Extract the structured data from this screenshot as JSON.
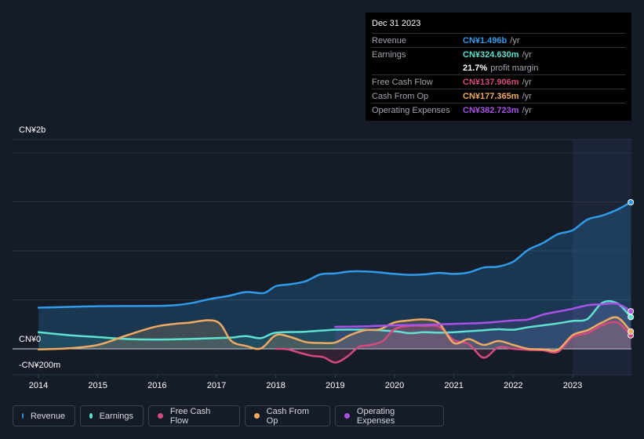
{
  "tooltip": {
    "date": "Dec 31 2023",
    "rows": [
      {
        "label": "Revenue",
        "value": "CN¥1.496b",
        "unit": "/yr",
        "color": "#2f9be9"
      },
      {
        "label": "Earnings",
        "value": "CN¥324.630m",
        "unit": "/yr",
        "color": "#5ee1d0"
      },
      {
        "label": "",
        "value": "21.7%",
        "unit": "profit margin",
        "color": "#ffffff"
      },
      {
        "label": "Free Cash Flow",
        "value": "CN¥137.906m",
        "unit": "/yr",
        "color": "#d6497e"
      },
      {
        "label": "Cash From Op",
        "value": "CN¥177.365m",
        "unit": "/yr",
        "color": "#eeaa62"
      },
      {
        "label": "Operating Expenses",
        "value": "CN¥382.723m",
        "unit": "/yr",
        "color": "#a952e8"
      }
    ]
  },
  "axis": {
    "y_top": "CN¥2b",
    "y_zero": "CN¥0",
    "y_bottom": "-CN¥200m"
  },
  "legend": [
    {
      "label": "Revenue",
      "color": "#2f9be9"
    },
    {
      "label": "Earnings",
      "color": "#5ee1d0"
    },
    {
      "label": "Free Cash Flow",
      "color": "#d6497e"
    },
    {
      "label": "Cash From Op",
      "color": "#eeaa62"
    },
    {
      "label": "Operating Expenses",
      "color": "#a952e8"
    }
  ],
  "chart_data": {
    "type": "line",
    "title": "",
    "xlabel": "",
    "ylabel": "",
    "x_ticks": [
      "2014",
      "2015",
      "2016",
      "2017",
      "2018",
      "2019",
      "2020",
      "2021",
      "2022",
      "2023"
    ],
    "ylim": [
      -200,
      2000
    ],
    "y_unit": "CN¥m",
    "highlight_start": 2023.0,
    "series": [
      {
        "name": "Revenue",
        "color": "#2f9be9",
        "points": [
          [
            2014.0,
            420
          ],
          [
            2014.5,
            428
          ],
          [
            2015.0,
            435
          ],
          [
            2015.5,
            437
          ],
          [
            2016.0,
            438
          ],
          [
            2016.3,
            445
          ],
          [
            2016.6,
            470
          ],
          [
            2016.9,
            510
          ],
          [
            2017.2,
            540
          ],
          [
            2017.5,
            580
          ],
          [
            2017.8,
            570
          ],
          [
            2018.0,
            640
          ],
          [
            2018.25,
            660
          ],
          [
            2018.5,
            690
          ],
          [
            2018.75,
            760
          ],
          [
            2019.0,
            770
          ],
          [
            2019.25,
            790
          ],
          [
            2019.5,
            790
          ],
          [
            2019.75,
            780
          ],
          [
            2020.0,
            765
          ],
          [
            2020.25,
            755
          ],
          [
            2020.5,
            760
          ],
          [
            2020.75,
            775
          ],
          [
            2021.0,
            765
          ],
          [
            2021.25,
            780
          ],
          [
            2021.5,
            830
          ],
          [
            2021.75,
            840
          ],
          [
            2022.0,
            890
          ],
          [
            2022.25,
            1010
          ],
          [
            2022.5,
            1080
          ],
          [
            2022.75,
            1170
          ],
          [
            2023.0,
            1210
          ],
          [
            2023.25,
            1320
          ],
          [
            2023.5,
            1360
          ],
          [
            2023.75,
            1420
          ],
          [
            2023.98,
            1496
          ]
        ]
      },
      {
        "name": "Earnings",
        "color": "#5ee1d0",
        "points": [
          [
            2014.0,
            170
          ],
          [
            2014.5,
            140
          ],
          [
            2015.0,
            120
          ],
          [
            2015.5,
            100
          ],
          [
            2016.0,
            95
          ],
          [
            2016.5,
            100
          ],
          [
            2017.0,
            110
          ],
          [
            2017.25,
            115
          ],
          [
            2017.5,
            130
          ],
          [
            2017.75,
            110
          ],
          [
            2018.0,
            165
          ],
          [
            2018.5,
            175
          ],
          [
            2019.0,
            195
          ],
          [
            2019.5,
            195
          ],
          [
            2020.0,
            180
          ],
          [
            2020.25,
            160
          ],
          [
            2020.5,
            170
          ],
          [
            2020.75,
            165
          ],
          [
            2021.0,
            170
          ],
          [
            2021.25,
            180
          ],
          [
            2021.5,
            190
          ],
          [
            2021.75,
            200
          ],
          [
            2022.0,
            195
          ],
          [
            2022.25,
            220
          ],
          [
            2022.5,
            240
          ],
          [
            2022.75,
            260
          ],
          [
            2023.0,
            285
          ],
          [
            2023.25,
            305
          ],
          [
            2023.5,
            470
          ],
          [
            2023.75,
            465
          ],
          [
            2023.98,
            325
          ]
        ]
      },
      {
        "name": "Free Cash Flow",
        "color": "#d6497e",
        "points": [
          [
            2018.0,
            0
          ],
          [
            2018.2,
            -5
          ],
          [
            2018.4,
            -40
          ],
          [
            2018.6,
            -70
          ],
          [
            2018.8,
            -85
          ],
          [
            2019.0,
            -140
          ],
          [
            2019.2,
            -80
          ],
          [
            2019.4,
            20
          ],
          [
            2019.6,
            40
          ],
          [
            2019.8,
            80
          ],
          [
            2020.0,
            200
          ],
          [
            2020.25,
            235
          ],
          [
            2020.5,
            235
          ],
          [
            2020.75,
            225
          ],
          [
            2021.0,
            90
          ],
          [
            2021.25,
            50
          ],
          [
            2021.5,
            -90
          ],
          [
            2021.75,
            15
          ],
          [
            2022.0,
            0
          ],
          [
            2022.25,
            -10
          ],
          [
            2022.5,
            -15
          ],
          [
            2022.75,
            -30
          ],
          [
            2023.0,
            120
          ],
          [
            2023.25,
            160
          ],
          [
            2023.5,
            240
          ],
          [
            2023.75,
            270
          ],
          [
            2023.98,
            138
          ]
        ]
      },
      {
        "name": "Cash From Op",
        "color": "#eeaa62",
        "points": [
          [
            2014.0,
            -5
          ],
          [
            2014.5,
            5
          ],
          [
            2015.0,
            40
          ],
          [
            2015.5,
            140
          ],
          [
            2016.0,
            230
          ],
          [
            2016.5,
            265
          ],
          [
            2017.0,
            280
          ],
          [
            2017.25,
            80
          ],
          [
            2017.5,
            30
          ],
          [
            2017.75,
            5
          ],
          [
            2018.0,
            140
          ],
          [
            2018.25,
            120
          ],
          [
            2018.5,
            70
          ],
          [
            2018.75,
            60
          ],
          [
            2019.0,
            65
          ],
          [
            2019.25,
            140
          ],
          [
            2019.5,
            190
          ],
          [
            2019.75,
            200
          ],
          [
            2020.0,
            270
          ],
          [
            2020.25,
            290
          ],
          [
            2020.5,
            300
          ],
          [
            2020.75,
            260
          ],
          [
            2021.0,
            60
          ],
          [
            2021.25,
            100
          ],
          [
            2021.5,
            40
          ],
          [
            2021.75,
            80
          ],
          [
            2022.0,
            40
          ],
          [
            2022.25,
            0
          ],
          [
            2022.5,
            -5
          ],
          [
            2022.75,
            -10
          ],
          [
            2023.0,
            140
          ],
          [
            2023.25,
            190
          ],
          [
            2023.5,
            270
          ],
          [
            2023.75,
            320
          ],
          [
            2023.98,
            177
          ]
        ]
      },
      {
        "name": "Operating Expenses",
        "color": "#a952e8",
        "points": [
          [
            2019.0,
            225
          ],
          [
            2019.5,
            230
          ],
          [
            2020.0,
            240
          ],
          [
            2020.5,
            245
          ],
          [
            2021.0,
            255
          ],
          [
            2021.5,
            265
          ],
          [
            2022.0,
            290
          ],
          [
            2022.25,
            300
          ],
          [
            2022.5,
            350
          ],
          [
            2022.75,
            380
          ],
          [
            2023.0,
            410
          ],
          [
            2023.25,
            445
          ],
          [
            2023.5,
            455
          ],
          [
            2023.75,
            460
          ],
          [
            2023.98,
            383
          ]
        ]
      }
    ]
  }
}
